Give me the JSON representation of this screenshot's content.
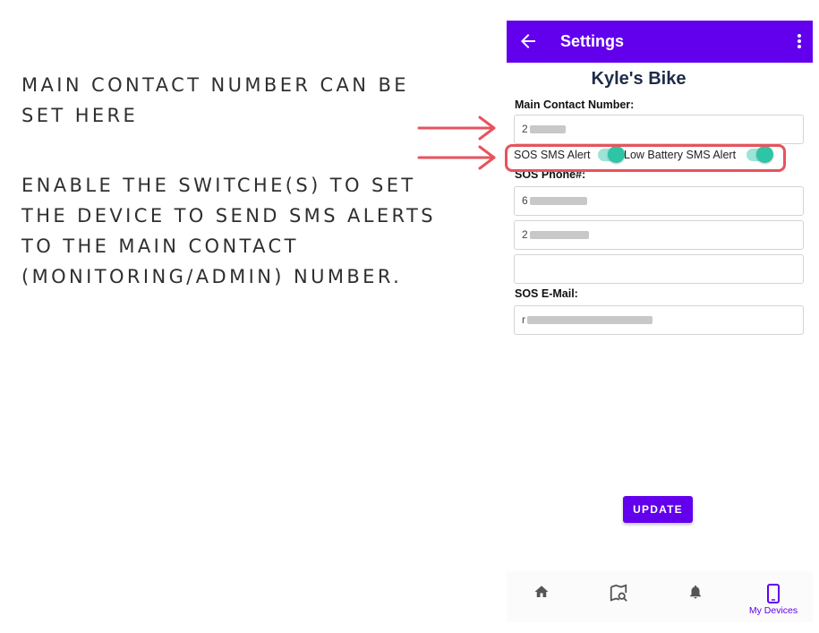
{
  "instructions": {
    "main_contact": "MAIN CONTACT NUMBER CAN BE SET HERE",
    "switches": "ENABLE THE SWITCHE(S) TO SET THE DEVICE TO SEND SMS ALERTS TO THE MAIN CONTACT (MONITORING/ADMIN) NUMBER."
  },
  "colors": {
    "primary": "#6200ee",
    "switch_on": "#2ec4a6",
    "annotation": "#e8535d"
  },
  "appbar": {
    "title": "Settings",
    "back_icon": "arrow-left-icon",
    "menu_icon": "more-vert-icon"
  },
  "device": {
    "name": "Kyle's Bike"
  },
  "form": {
    "main_contact_label": "Main Contact Number:",
    "main_contact_value": "2",
    "sos_sms_label": "SOS SMS Alert",
    "sos_sms_enabled": true,
    "low_battery_label": "Low Battery SMS Alert",
    "low_battery_enabled": true,
    "sos_phone_label": "SOS Phone#:",
    "sos_phones": [
      "6",
      "2",
      ""
    ],
    "sos_email_label": "SOS E-Mail:",
    "sos_email_value": "r",
    "update_label": "UPDATE"
  },
  "bottom_nav": [
    {
      "icon": "home-icon",
      "label": ""
    },
    {
      "icon": "map-search-icon",
      "label": ""
    },
    {
      "icon": "bell-icon",
      "label": ""
    },
    {
      "icon": "phone-device-icon",
      "label": "My Devices",
      "active": true
    }
  ]
}
